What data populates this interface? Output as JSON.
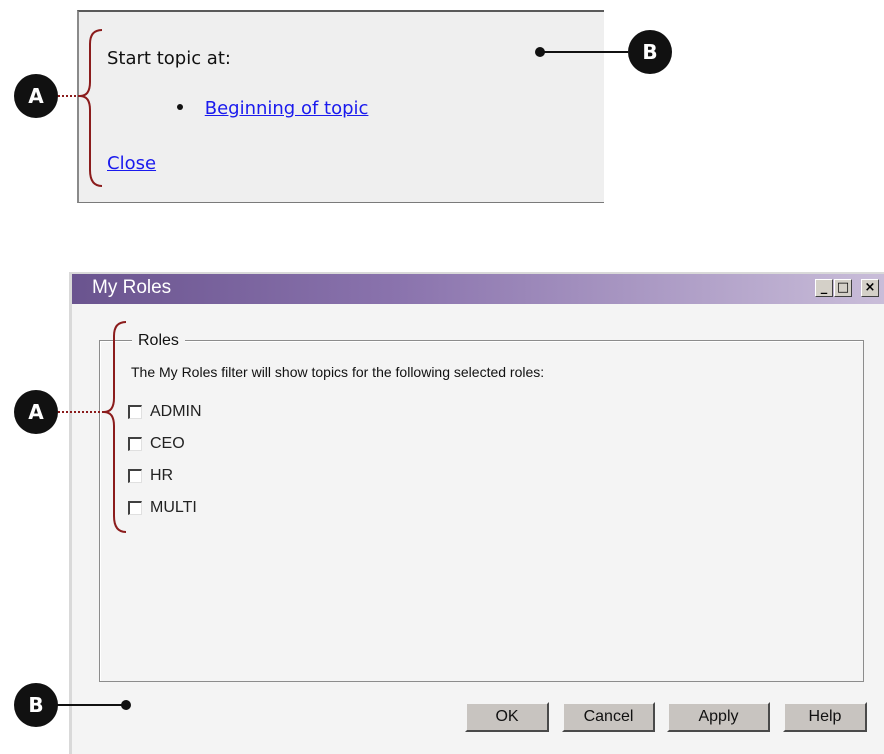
{
  "popup": {
    "start_label": "Start topic at:",
    "topic_link": "Beginning of topic",
    "close_link": "Close",
    "link_color": "#1a1aee"
  },
  "callouts": {
    "top_a": "A",
    "top_b": "B",
    "bottom_a": "A",
    "bottom_b": "B",
    "bracket_color": "#8b1c1c"
  },
  "dialog": {
    "title": "My Roles",
    "window_buttons": [
      "_",
      "□",
      "×"
    ],
    "group_label": "Roles",
    "description": "The My Roles filter will show topics for the following selected roles:",
    "roles": [
      {
        "label": "ADMIN",
        "checked": false
      },
      {
        "label": "CEO",
        "checked": false
      },
      {
        "label": "HR",
        "checked": false
      },
      {
        "label": "MULTI",
        "checked": false
      }
    ],
    "buttons": {
      "ok": "OK",
      "cancel": "Cancel",
      "apply": "Apply",
      "help": "Help"
    },
    "title_bar_color": "#6a548f"
  }
}
